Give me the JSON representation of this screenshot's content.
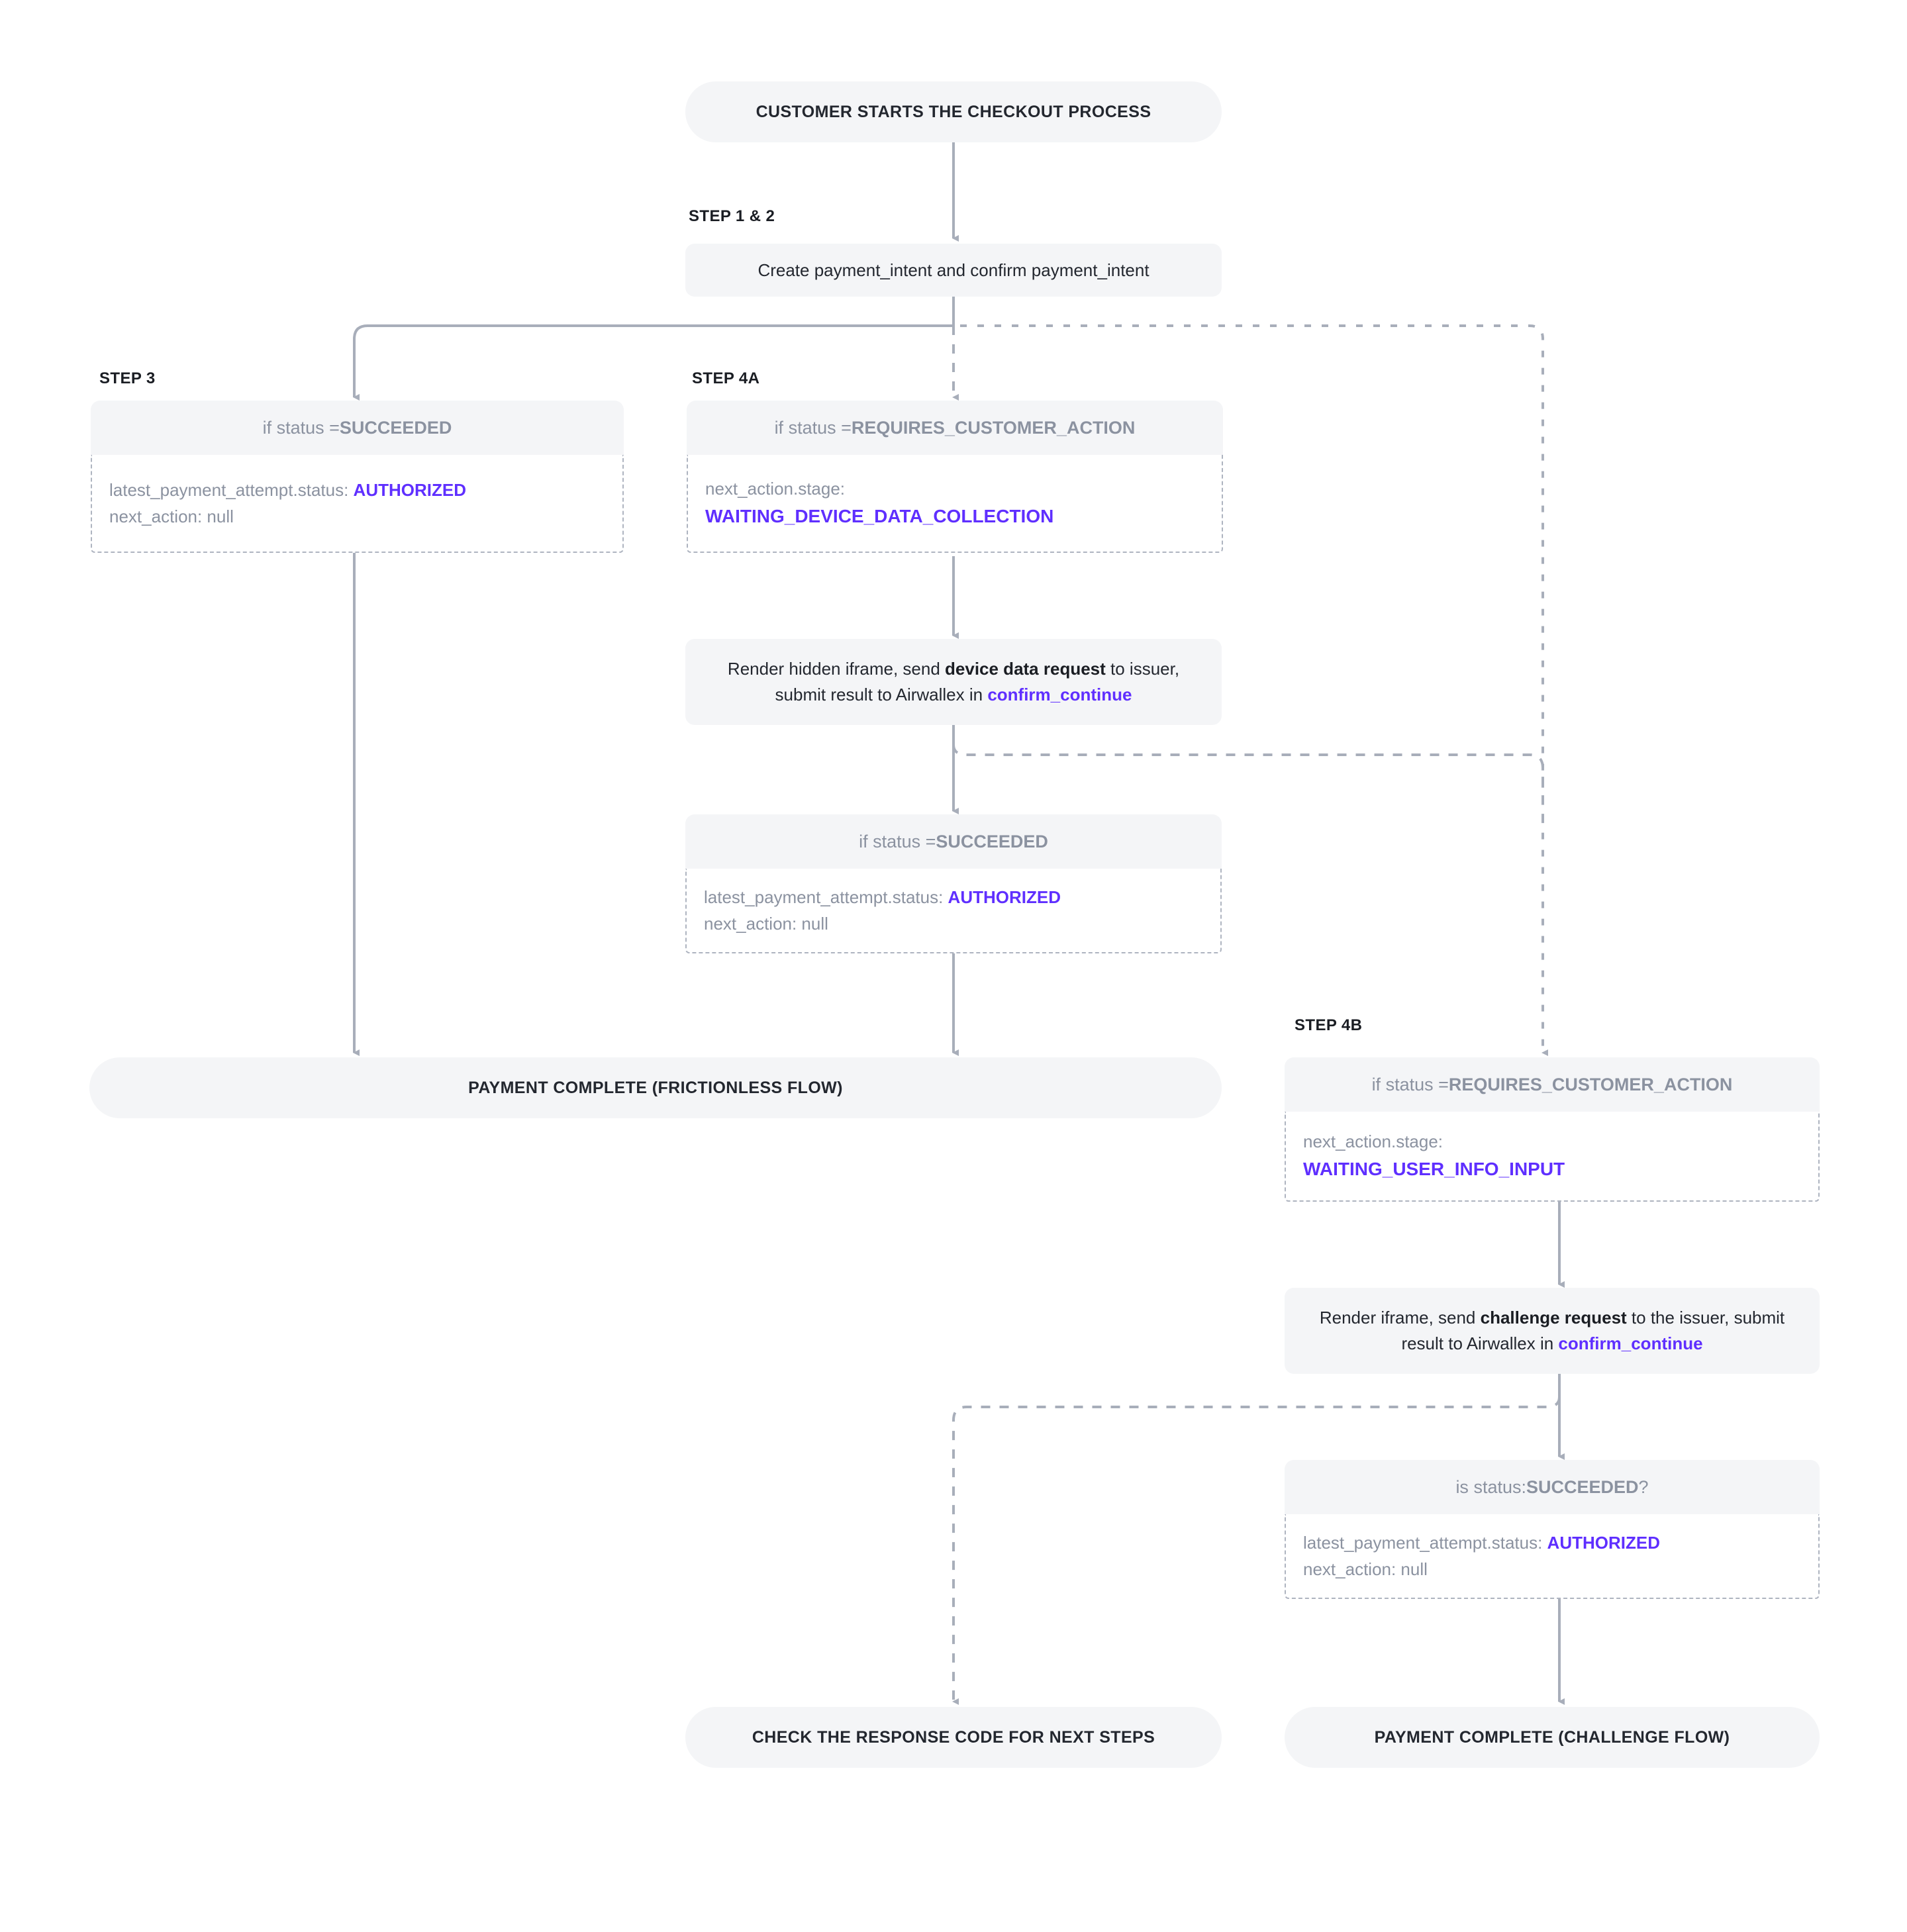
{
  "diagram": {
    "title_node": "CUSTOMER STARTS THE CHECKOUT PROCESS",
    "accent_purple": "#5F2FFF",
    "node_fill": "#F4F5F7",
    "line_gray": "#A8AEBA",
    "muted_text": "#8B92A0"
  },
  "step_labels": {
    "step12": "STEP 1 & 2",
    "step3": "STEP 3",
    "step4a": "STEP 4A",
    "step4b": "STEP 4B"
  },
  "nodes": {
    "start": {
      "label": "CUSTOMER STARTS THE CHECKOUT PROCESS"
    },
    "create_intent": {
      "label": "Create payment_intent and confirm payment_intent"
    },
    "step3_cond": {
      "prefix": "if status = ",
      "status": "SUCCEEDED",
      "line1_key": "latest_payment_attempt.status: ",
      "line1_val": "AUTHORIZED",
      "line2": "next_action: null"
    },
    "step4a_cond": {
      "prefix": "if status = ",
      "status": "REQUIRES_CUSTOMER_ACTION",
      "line1_key": "next_action.stage:",
      "line1_val": "WAITING_DEVICE_DATA_COLLECTION"
    },
    "step4a_action": {
      "p1": "Render hidden iframe, send ",
      "b1": "device data request",
      "p2": " to issuer, submit result to Airwallex in ",
      "h1": "confirm_continue"
    },
    "step4a_succeed": {
      "prefix": "if status = ",
      "status": "SUCCEEDED",
      "line1_key": "latest_payment_attempt.status: ",
      "line1_val": "AUTHORIZED",
      "line2": "next_action: null"
    },
    "frictionless": {
      "label": "PAYMENT COMPLETE (FRICTIONLESS FLOW)"
    },
    "step4b_cond": {
      "prefix": "if status = ",
      "status": "REQUIRES_CUSTOMER_ACTION",
      "line1_key": "next_action.stage:",
      "line1_val": "WAITING_USER_INFO_INPUT"
    },
    "step4b_action": {
      "p1": "Render iframe, send ",
      "b1": "challenge request",
      "p2": " to the issuer, submit result to Airwallex in ",
      "h1": "confirm_continue"
    },
    "step4b_succeed": {
      "prefix": "is status: ",
      "status": "SUCCEEDED",
      "suffix": " ?",
      "line1_key": "latest_payment_attempt.status: ",
      "line1_val": "AUTHORIZED",
      "line2": "next_action: null"
    },
    "check_response": {
      "label": "CHECK THE RESPONSE CODE FOR NEXT STEPS"
    },
    "challenge_complete": {
      "label": "PAYMENT COMPLETE (CHALLENGE FLOW)"
    }
  }
}
